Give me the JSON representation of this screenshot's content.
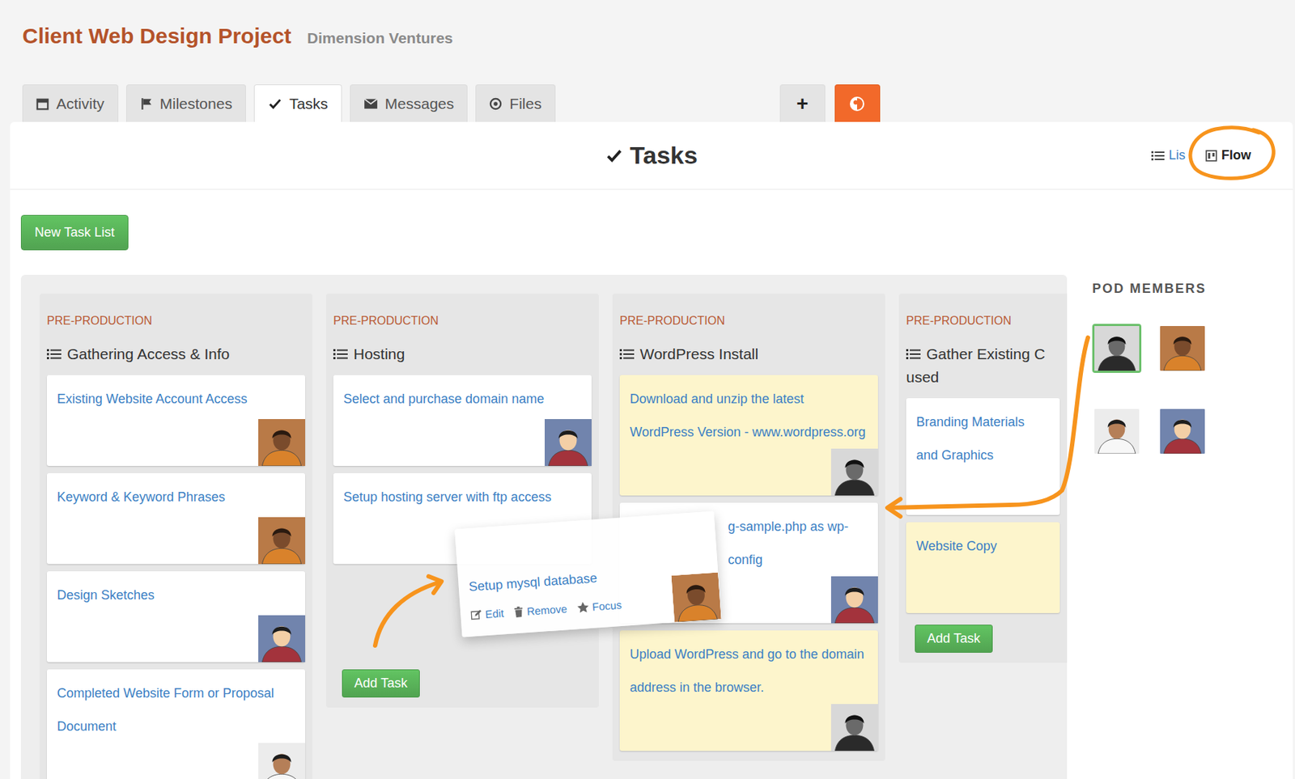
{
  "project": {
    "title": "Client Web Design Project",
    "client": "Dimension Ventures"
  },
  "tabs": [
    {
      "label": "Activity",
      "selected": false
    },
    {
      "label": "Milestones",
      "selected": false
    },
    {
      "label": "Tasks",
      "selected": true
    },
    {
      "label": "Messages",
      "selected": false
    },
    {
      "label": "Files",
      "selected": false
    }
  ],
  "toolbar": {
    "add": "+"
  },
  "panel": {
    "title": "Tasks"
  },
  "views": [
    {
      "label": "Lis",
      "selected": false
    },
    {
      "label": "Flow",
      "selected": true
    }
  ],
  "new_list_button": "New Task List",
  "columns": [
    {
      "phase": "PRE-PRODUCTION",
      "title_lines": [
        "Gathering Access & Info"
      ],
      "placeholder": false,
      "tasks": [
        {
          "text": "Existing Website Account Access",
          "color": "#ffffff",
          "covered": false,
          "avatar": "orange"
        },
        {
          "text": "Keyword & Keyword Phrases",
          "color": "#ffffff",
          "covered": false,
          "avatar": "orange"
        },
        {
          "text": "Design Sketches",
          "color": "#ffffff",
          "covered": false,
          "avatar": "cartoon"
        },
        {
          "text": "Completed Website Form or Proposal Document",
          "color": "#ffffff",
          "covered": false,
          "avatar": "suit"
        }
      ]
    },
    {
      "phase": "PRE-PRODUCTION",
      "title_lines": [
        "Hosting"
      ],
      "placeholder": true,
      "tasks": [
        {
          "text": "Select and purchase domain name",
          "color": "#ffffff",
          "covered": false,
          "avatar": "cartoon"
        },
        {
          "text": "Setup hosting server with ftp access",
          "color": "#ffffff",
          "covered": false
        }
      ],
      "add_button": "Add Task"
    },
    {
      "phase": "PRE-PRODUCTION",
      "title_lines": [
        "WordPress Install"
      ],
      "placeholder": false,
      "tasks": [
        {
          "text": "Download and unzip the latest WordPress Version - www.wordpress.org",
          "color": "#fdf5cc",
          "covered": false,
          "avatar": "mono"
        },
        {
          "text": "g-sample.php as wp-config",
          "color": "#ffffff",
          "covered": true,
          "avatar": "cartoon"
        },
        {
          "text": "Upload WordPress and go to the domain address in the browser.",
          "color": "#fdf5cc",
          "covered": false,
          "avatar": "mono"
        }
      ]
    },
    {
      "phase": "PRE-PRODUCTION",
      "title_lines": [
        "Gather Existing C",
        "used"
      ],
      "placeholder": false,
      "tasks": [
        {
          "text": "Branding Materials and Graphics",
          "color": "#ffffff",
          "covered": false
        },
        {
          "text": "Website Copy",
          "color": "#fdf5cc",
          "covered": false
        }
      ],
      "add_button": "Add Task"
    }
  ],
  "dragged_task": {
    "text": "Setup mysql database",
    "actions": [
      "Edit",
      "Remove",
      "Focus"
    ],
    "avatar": "orange"
  },
  "pod": {
    "title": "POD MEMBERS",
    "members": [
      {
        "avatar": "mono",
        "selected": true
      },
      {
        "avatar": "orange",
        "selected": false
      },
      {
        "avatar": "suit",
        "selected": false
      },
      {
        "avatar": "cartoon",
        "selected": false
      }
    ]
  }
}
